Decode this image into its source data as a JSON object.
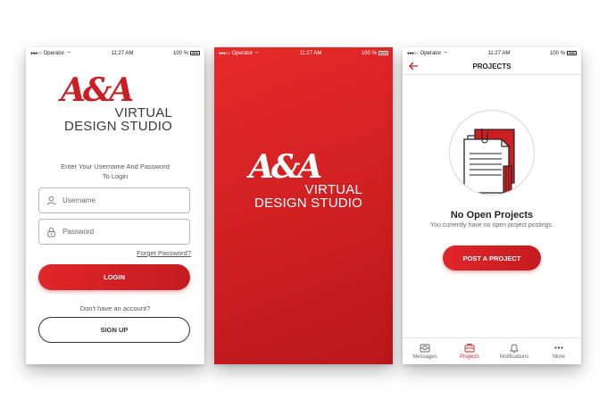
{
  "status_bar": {
    "carrier": "Operator",
    "time": "11:27 AM",
    "battery": "100 %"
  },
  "logo": {
    "mark": "A&A",
    "line1": "VIRTUAL",
    "line2": "DESIGN STUDIO"
  },
  "login": {
    "instruction_line1": "Enter Your Username And Password",
    "instruction_line2": "To Login",
    "username_placeholder": "Username",
    "password_placeholder": "Password",
    "forgot_link": "Forget Password?",
    "login_button": "LOGIN",
    "no_account_text": "Don't have an account?",
    "signup_button": "SIGN UP"
  },
  "projects": {
    "title": "PROJECTS",
    "empty_title": "No Open Projects",
    "empty_subtitle": "You currently have no open project postings.",
    "post_button": "POST A PROJECT",
    "tabs": [
      {
        "label": "Messages",
        "icon": "inbox-icon",
        "active": false
      },
      {
        "label": "Projects",
        "icon": "briefcase-icon",
        "active": true
      },
      {
        "label": "Notifications",
        "icon": "bell-icon",
        "active": false
      },
      {
        "label": "More",
        "icon": "more-icon",
        "active": false
      }
    ]
  },
  "colors": {
    "brand_red": "#cc1f24",
    "text_dark": "#222222",
    "text_muted": "#666666"
  }
}
